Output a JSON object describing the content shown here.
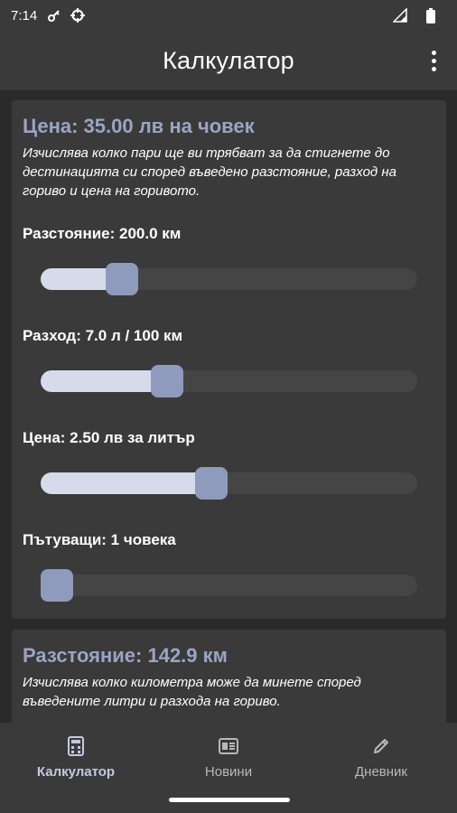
{
  "status_bar": {
    "time": "7:14",
    "icons": [
      "key-icon",
      "crosshair-icon",
      "signal-icon",
      "battery-icon"
    ]
  },
  "app_bar": {
    "title": "Калкулатор",
    "menu_icon": "more-vert-icon"
  },
  "price_card": {
    "title": "Цена: 35.00 лв на човек",
    "description": "Изчислява колко пари ще ви трябват за да стигнете до дестинацията си според въведено разстояние, разход на гориво и цена на горивото.",
    "sliders": [
      {
        "label": "Разстояние: 200.0 км",
        "fraction": 0.19
      },
      {
        "label": "Разход: 7.0 л / 100 км",
        "fraction": 0.32
      },
      {
        "label": "Цена: 2.50 лв за литър",
        "fraction": 0.45
      },
      {
        "label": "Пътуващи: 1 човека",
        "fraction": 0.0
      }
    ]
  },
  "distance_card": {
    "title": "Разстояние: 142.9 км",
    "description": "Изчислява колко километра може да минете според въведените литри и разхода на гориво."
  },
  "bottom_nav": {
    "items": [
      {
        "label": "Калкулатор",
        "icon": "calculator-icon",
        "active": true
      },
      {
        "label": "Новини",
        "icon": "news-icon",
        "active": false
      },
      {
        "label": "Дневник",
        "icon": "pencil-icon",
        "active": false
      }
    ]
  },
  "colors": {
    "background": "#2a2a2a",
    "surface": "#3a3a3a",
    "accent": "#9aa5c4",
    "slider_fill": "#d5dbeb",
    "slider_thumb": "#8f9bbd",
    "slider_track": "#454545"
  }
}
